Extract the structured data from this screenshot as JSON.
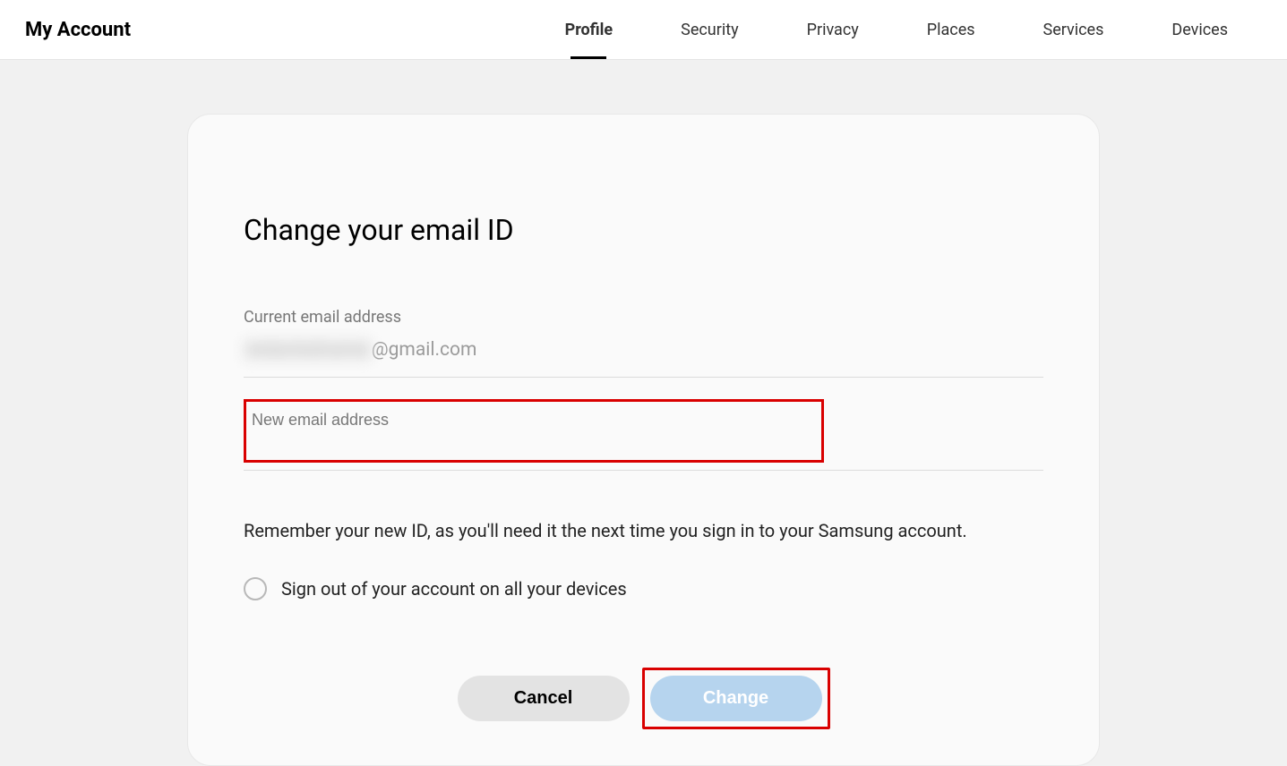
{
  "header": {
    "title": "My Account",
    "nav": [
      {
        "label": "Profile",
        "active": true
      },
      {
        "label": "Security",
        "active": false
      },
      {
        "label": "Privacy",
        "active": false
      },
      {
        "label": "Places",
        "active": false
      },
      {
        "label": "Services",
        "active": false
      },
      {
        "label": "Devices",
        "active": false
      }
    ]
  },
  "card": {
    "title": "Change your email ID",
    "current_label": "Current email address",
    "current_suffix": "@gmail.com",
    "new_email_placeholder": "New email address",
    "info_text": "Remember your new ID, as you'll need it the next time you sign in to your Samsung account.",
    "signout_label": "Sign out of your account on all your devices",
    "cancel_label": "Cancel",
    "change_label": "Change"
  }
}
